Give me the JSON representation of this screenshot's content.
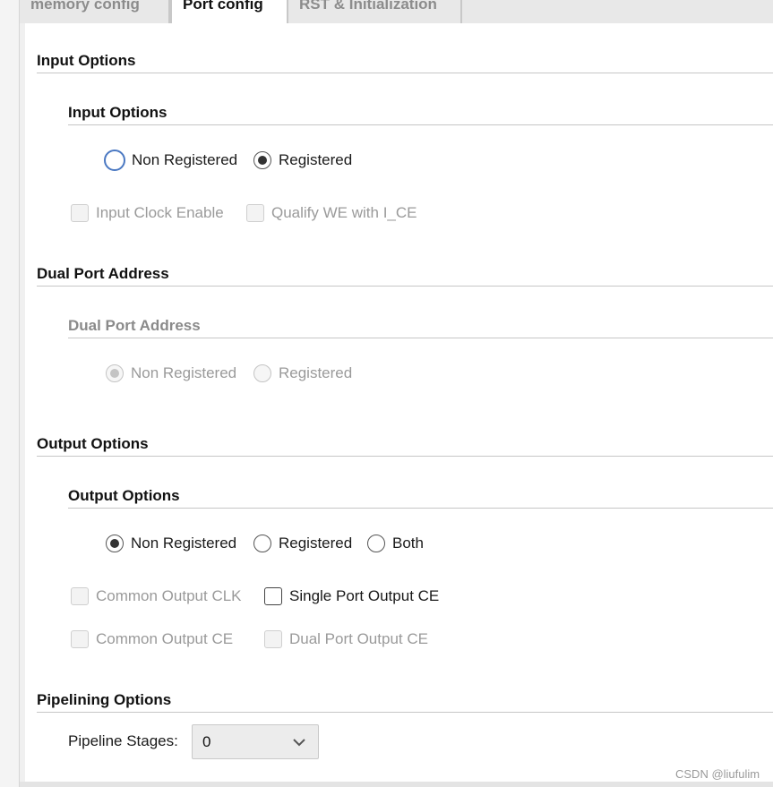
{
  "tabs": [
    {
      "label": "memory config"
    },
    {
      "label": "Port config"
    },
    {
      "label": "RST & Initialization"
    }
  ],
  "input_options": {
    "section_title": "Input Options",
    "group_title": "Input Options",
    "radios": [
      {
        "label": "Non Registered",
        "checked": false
      },
      {
        "label": "Registered",
        "checked": true
      }
    ],
    "checkboxes": [
      {
        "label": "Input Clock Enable"
      },
      {
        "label": "Qualify WE with I_CE"
      }
    ]
  },
  "dual_port_address": {
    "section_title": "Dual Port Address",
    "group_title": "Dual Port Address",
    "radios": [
      {
        "label": "Non Registered",
        "checked": true
      },
      {
        "label": "Registered",
        "checked": false
      }
    ]
  },
  "output_options": {
    "section_title": "Output Options",
    "group_title": "Output Options",
    "radios": [
      {
        "label": "Non Registered",
        "checked": true
      },
      {
        "label": "Registered",
        "checked": false
      },
      {
        "label": "Both",
        "checked": false
      }
    ],
    "checkboxes": [
      {
        "label": "Common Output CLK"
      },
      {
        "label": "Single Port Output CE"
      },
      {
        "label": "Common Output CE"
      },
      {
        "label": "Dual Port Output CE"
      }
    ]
  },
  "pipelining_options": {
    "section_title": "Pipelining Options",
    "stages_label": "Pipeline Stages:",
    "stages_value": "0"
  },
  "watermark": "CSDN @liufulim",
  "colors": {
    "focus_ring": "#4a78c2",
    "disabled_text": "#9a9a9a",
    "rule": "#c6c6c6"
  }
}
